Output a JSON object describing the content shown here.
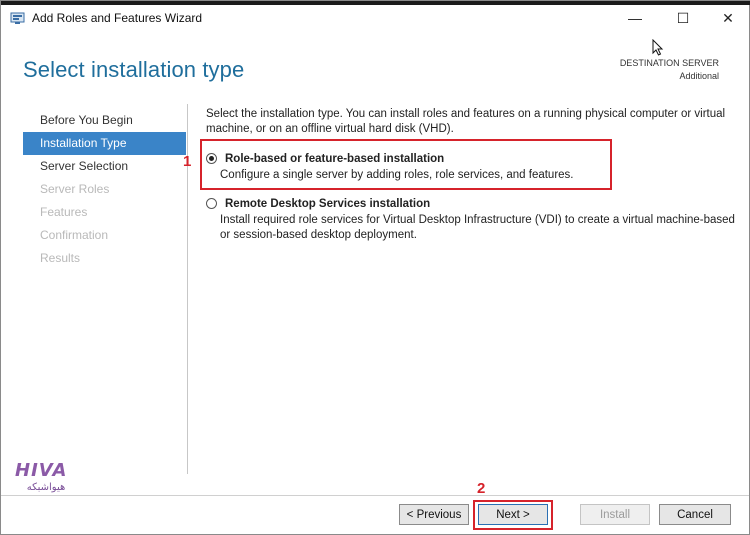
{
  "window": {
    "title": "Add Roles and Features Wizard",
    "controls": {
      "minimize": "—",
      "maximize": "☐",
      "close": "✕"
    }
  },
  "page": {
    "title": "Select installation type",
    "destination_label": "DESTINATION SERVER",
    "destination_value": "Additional"
  },
  "nav": {
    "items": [
      {
        "label": "Before You Begin",
        "state": "normal"
      },
      {
        "label": "Installation Type",
        "state": "active"
      },
      {
        "label": "Server Selection",
        "state": "normal"
      },
      {
        "label": "Server Roles",
        "state": "disabled"
      },
      {
        "label": "Features",
        "state": "disabled"
      },
      {
        "label": "Confirmation",
        "state": "disabled"
      },
      {
        "label": "Results",
        "state": "disabled"
      }
    ]
  },
  "content": {
    "description": "Select the installation type. You can install roles and features on a running physical computer or virtual machine, or on an offline virtual hard disk (VHD).",
    "options": [
      {
        "title": "Role-based or feature-based installation",
        "description": "Configure a single server by adding roles, role services, and features.",
        "selected": true
      },
      {
        "title": "Remote Desktop Services installation",
        "description": "Install required role services for Virtual Desktop Infrastructure (VDI) to create a virtual machine-based or session-based desktop deployment.",
        "selected": false
      }
    ]
  },
  "buttons": {
    "previous": "< Previous",
    "next": "Next >",
    "install": "Install",
    "cancel": "Cancel"
  },
  "annotations": {
    "step1": "1",
    "step2": "2"
  },
  "watermark": {
    "latin": "HIVA",
    "persian": "هیواشبکه"
  },
  "colors": {
    "title_blue": "#1f6e9c",
    "nav_active": "#3a84c8",
    "annotation_red": "#d6232b"
  }
}
